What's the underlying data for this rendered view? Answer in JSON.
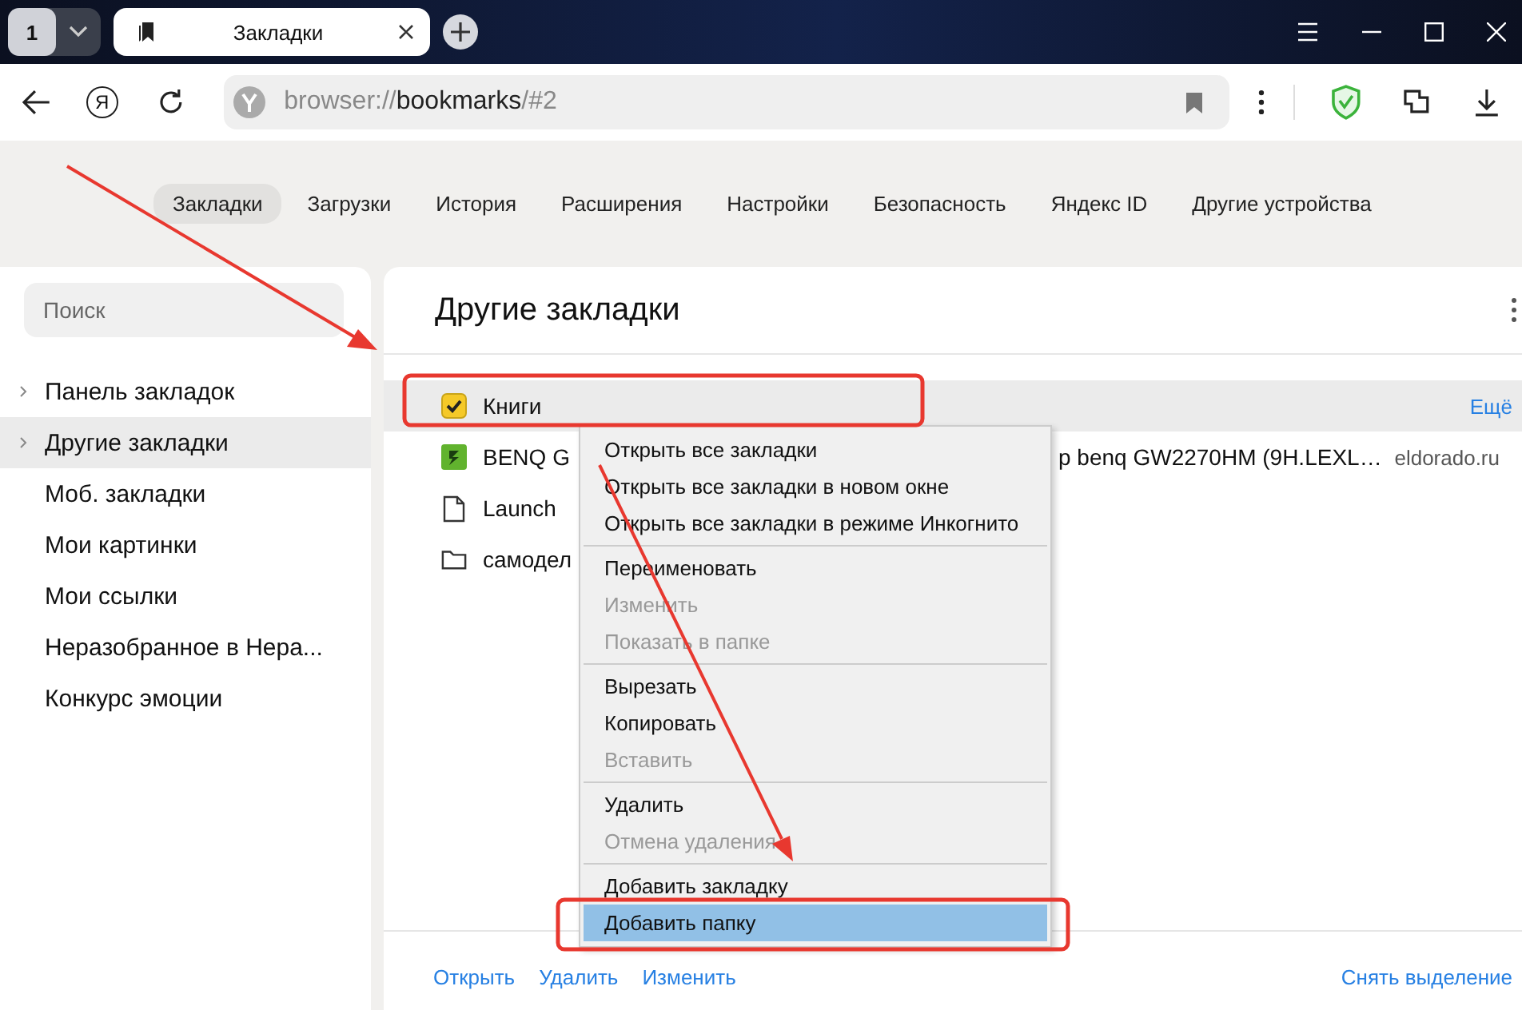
{
  "tab_counter": "1",
  "tab": {
    "title": "Закладки"
  },
  "address": {
    "scheme": "browser://",
    "host": "bookmarks",
    "path": "/#2"
  },
  "yandex_button": "Я",
  "nav": [
    {
      "label": "Закладки",
      "selected": true
    },
    {
      "label": "Загрузки",
      "selected": false
    },
    {
      "label": "История",
      "selected": false
    },
    {
      "label": "Расширения",
      "selected": false
    },
    {
      "label": "Настройки",
      "selected": false
    },
    {
      "label": "Безопасность",
      "selected": false
    },
    {
      "label": "Яндекс ID",
      "selected": false
    },
    {
      "label": "Другие устройства",
      "selected": false
    }
  ],
  "sidebar": {
    "search": {
      "placeholder": "Поиск"
    },
    "items": [
      {
        "label": "Панель закладок",
        "expandable": true,
        "selected": false
      },
      {
        "label": "Другие закладки",
        "expandable": true,
        "selected": true
      },
      {
        "label": "Моб. закладки",
        "expandable": false,
        "selected": false
      },
      {
        "label": "Мои картинки",
        "expandable": false,
        "selected": false
      },
      {
        "label": "Мои ссылки",
        "expandable": false,
        "selected": false
      },
      {
        "label": "Неразобранное в Нера...",
        "expandable": false,
        "selected": false
      },
      {
        "label": "Конкурс эмоции",
        "expandable": false,
        "selected": false
      }
    ]
  },
  "folder": {
    "title": "Другие закладки",
    "rows": [
      {
        "kind": "checkbox",
        "title": "Книги",
        "selected": true,
        "more": "Ещё"
      },
      {
        "kind": "site",
        "title": "BENQ G",
        "title_end": "p benq GW2270HM (9H.LEXL…",
        "domain": "eldorado.ru",
        "selected": false
      },
      {
        "kind": "page",
        "title": "Launch",
        "selected": false
      },
      {
        "kind": "folder",
        "title": "самодел",
        "selected": false
      }
    ],
    "actions": [
      "Открыть",
      "Удалить",
      "Изменить"
    ],
    "clear": "Снять выделение"
  },
  "context_menu": [
    {
      "kind": "item",
      "label": "Открыть все закладки",
      "disabled": false,
      "selected": false
    },
    {
      "kind": "item",
      "label": "Открыть все закладки в новом окне",
      "disabled": false,
      "selected": false
    },
    {
      "kind": "item",
      "label": "Открыть все закладки в режиме Инкогнито",
      "disabled": false,
      "selected": false
    },
    {
      "kind": "separator"
    },
    {
      "kind": "item",
      "label": "Переименовать",
      "disabled": false,
      "selected": false
    },
    {
      "kind": "item",
      "label": "Изменить",
      "disabled": true,
      "selected": false
    },
    {
      "kind": "item",
      "label": "Показать в папке",
      "disabled": true,
      "selected": false
    },
    {
      "kind": "separator"
    },
    {
      "kind": "item",
      "label": "Вырезать",
      "disabled": false,
      "selected": false
    },
    {
      "kind": "item",
      "label": "Копировать",
      "disabled": false,
      "selected": false
    },
    {
      "kind": "item",
      "label": "Вставить",
      "disabled": true,
      "selected": false
    },
    {
      "kind": "separator"
    },
    {
      "kind": "item",
      "label": "Удалить",
      "disabled": false,
      "selected": false
    },
    {
      "kind": "item",
      "label": "Отмена удаления",
      "disabled": true,
      "selected": false
    },
    {
      "kind": "separator"
    },
    {
      "kind": "item",
      "label": "Добавить закладку",
      "disabled": false,
      "selected": false
    },
    {
      "kind": "item",
      "label": "Добавить папку",
      "disabled": false,
      "selected": true
    }
  ]
}
